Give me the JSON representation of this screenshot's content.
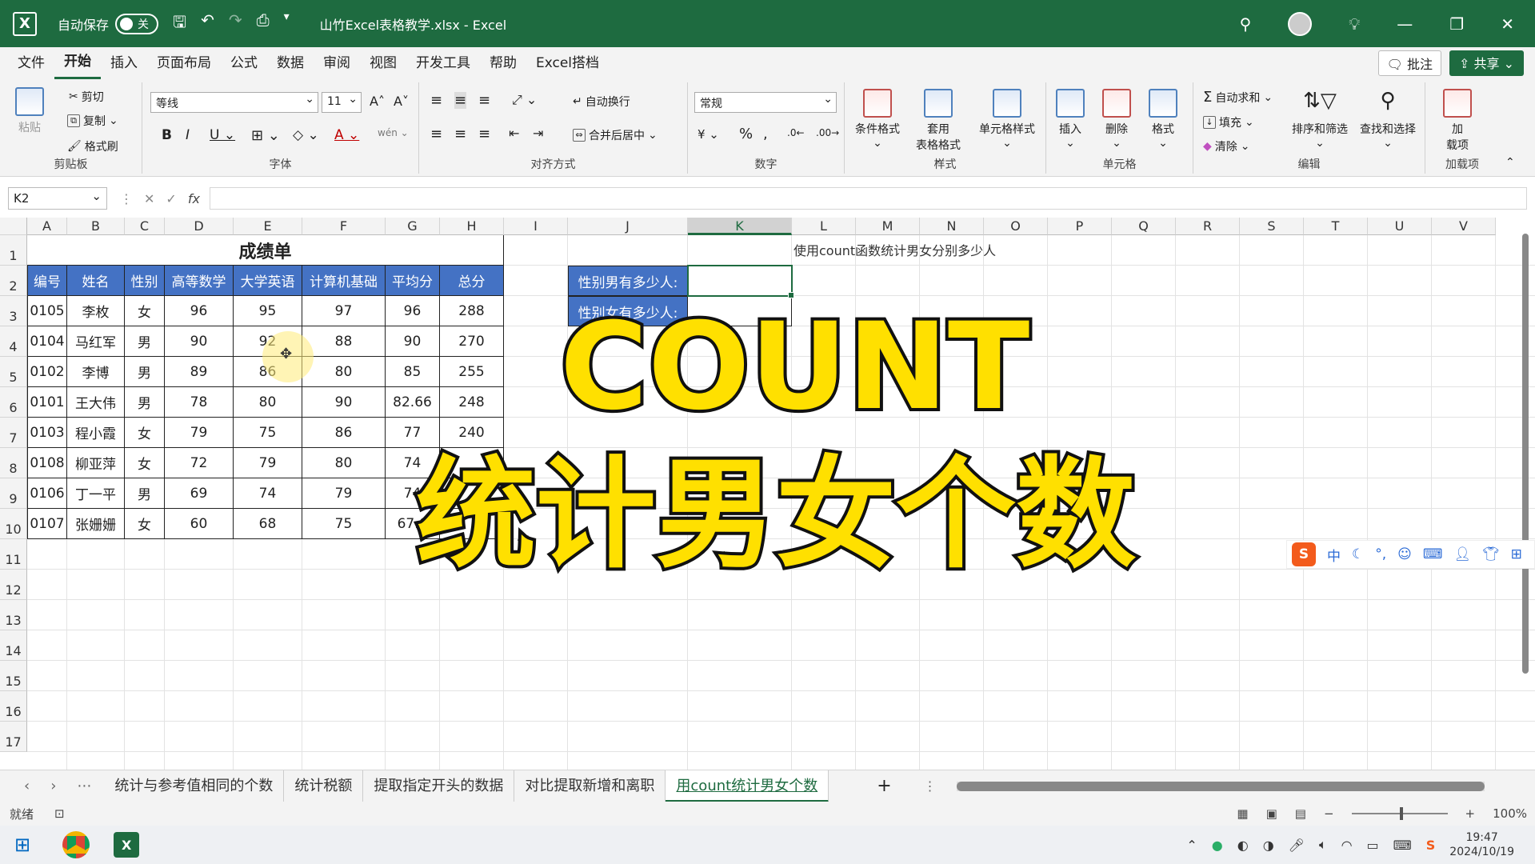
{
  "titlebar": {
    "app_icon": "excel-logo",
    "autosave_label": "自动保存",
    "autosave_state": "关",
    "doc_title": "山竹Excel表格教学.xlsx  -  Excel"
  },
  "menu": {
    "tabs": [
      "文件",
      "开始",
      "插入",
      "页面布局",
      "公式",
      "数据",
      "审阅",
      "视图",
      "开发工具",
      "帮助",
      "Excel搭档"
    ],
    "active": "开始",
    "comment": "批注",
    "share": "共享"
  },
  "ribbon": {
    "clipboard": {
      "name": "剪贴板",
      "paste": "粘贴",
      "cut": "剪切",
      "copy": "复制",
      "format_painter": "格式刷"
    },
    "font": {
      "name": "字体",
      "family": "等线",
      "size": "11"
    },
    "alignment": {
      "name": "对齐方式",
      "wrap": "自动换行",
      "merge": "合并后居中"
    },
    "number": {
      "name": "数字",
      "format": "常规"
    },
    "styles": {
      "name": "样式",
      "conditional": "条件格式",
      "table_line1": "套用",
      "table_line2": "表格格式",
      "cell_styles": "单元格样式"
    },
    "cells": {
      "name": "单元格",
      "insert": "插入",
      "delete": "删除",
      "format": "格式"
    },
    "editing": {
      "name": "编辑",
      "autosum": "自动求和",
      "fill": "填充",
      "clear": "清除",
      "sort": "排序和筛选",
      "find": "查找和选择"
    },
    "addins": {
      "name": "加载项",
      "line1": "加",
      "line2": "载项"
    }
  },
  "formula_bar": {
    "name_box": "K2",
    "fx": "fx",
    "formula": ""
  },
  "columns": [
    "A",
    "B",
    "C",
    "D",
    "E",
    "F",
    "G",
    "H",
    "I",
    "J",
    "K",
    "L",
    "M",
    "N",
    "O",
    "P",
    "Q",
    "R",
    "S",
    "T",
    "U",
    "V"
  ],
  "selected_column": "K",
  "rows": [
    "1",
    "2",
    "3",
    "4",
    "5",
    "6",
    "7",
    "8",
    "9",
    "10",
    "11",
    "12",
    "13",
    "14",
    "15",
    "16",
    "17"
  ],
  "table": {
    "title": "成绩单",
    "headers": [
      "编号",
      "姓名",
      "性别",
      "高等数学",
      "大学英语",
      "计算机基础",
      "平均分",
      "总分"
    ],
    "rows": [
      [
        "0105",
        "李枚",
        "女",
        "96",
        "95",
        "97",
        "96",
        "288"
      ],
      [
        "0104",
        "马红军",
        "男",
        "90",
        "92",
        "88",
        "90",
        "270"
      ],
      [
        "0102",
        "李博",
        "男",
        "89",
        "86",
        "80",
        "85",
        "255"
      ],
      [
        "0101",
        "王大伟",
        "男",
        "78",
        "80",
        "90",
        "82.66",
        "248"
      ],
      [
        "0103",
        "程小霞",
        "女",
        "79",
        "75",
        "86",
        "77",
        "240"
      ],
      [
        "0108",
        "柳亚萍",
        "女",
        "72",
        "79",
        "80",
        "74",
        ""
      ],
      [
        "0106",
        "丁一平",
        "男",
        "69",
        "74",
        "79",
        "74",
        ""
      ],
      [
        "0107",
        "张姗姗",
        "女",
        "60",
        "68",
        "75",
        "67.6",
        ""
      ]
    ]
  },
  "note": "使用count函数统计男女分别多少人",
  "questions": [
    "性别男有多少人:",
    "性别女有多少人:"
  ],
  "overlay": {
    "line1": "COUNT",
    "line2": "统计男女个数"
  },
  "sheets": [
    "统计与参考值相同的个数",
    "统计税额",
    "提取指定开头的数据",
    "对比提取新增和离职",
    "用count统计男女个数"
  ],
  "active_sheet": "用count统计男女个数",
  "status": {
    "ready": "就绪",
    "zoom": "100%"
  },
  "ime": {
    "logo": "S",
    "mode": "中"
  },
  "taskbar": {
    "time": "19:47",
    "date": "2024/10/19"
  },
  "colors": {
    "excel_green": "#1e6b40",
    "table_header": "#4472c4",
    "overlay_yellow": "#ffe000"
  }
}
